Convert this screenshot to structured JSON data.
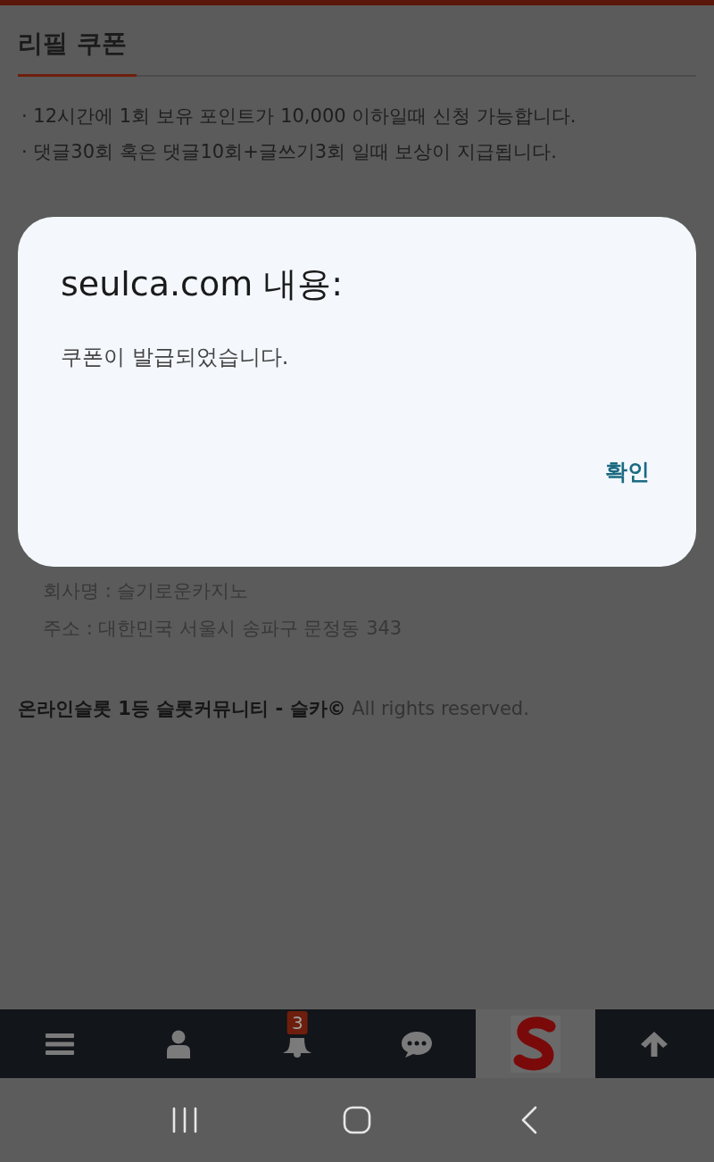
{
  "page": {
    "title": "리필 쿠폰",
    "notes": [
      "· 12시간에 1회 보유 포인트가 10,000 이하일때 신청 가능합니다.",
      "· 댓글30회 혹은 댓글10회+글쓰기3회 일때 보상이 지급됩니다."
    ],
    "company": [
      "회사명 : 슬기로운카지노",
      "주소 : 대한민국 서울시 송파구 문정동 343"
    ],
    "footer": "**온라인슬롯 1등 슬롯커뮤니티 - 슬카©** All rights reserved."
  },
  "bottom_nav": [
    {
      "kind": "menu"
    },
    {
      "kind": "user"
    },
    {
      "kind": "bell",
      "badge": "3"
    },
    {
      "kind": "chat"
    },
    {
      "kind": "logo"
    },
    {
      "kind": "top"
    }
  ],
  "system_nav": [
    {
      "kind": "recents"
    },
    {
      "kind": "home"
    },
    {
      "kind": "back"
    }
  ],
  "dialog": {
    "title": "seulca.com 내용:",
    "message": "쿠폰이 발급되었습니다.",
    "button": "확인"
  }
}
